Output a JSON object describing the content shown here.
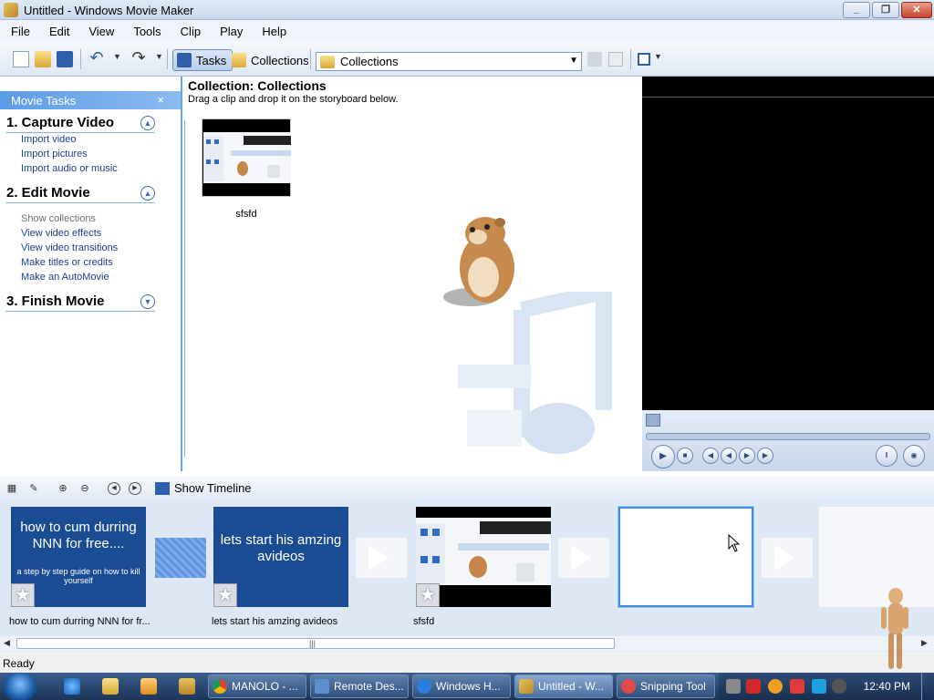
{
  "window": {
    "title": "Untitled - Windows Movie Maker"
  },
  "menu": [
    "File",
    "Edit",
    "View",
    "Tools",
    "Clip",
    "Play",
    "Help"
  ],
  "toolbar": {
    "tasks_label": "Tasks",
    "collections_label": "Collections",
    "collection_select": "Collections"
  },
  "tasks": {
    "header": "Movie Tasks",
    "close": "×",
    "sections": [
      {
        "title": "1. Capture Video",
        "links": [
          "Import video",
          "Import pictures",
          "Import audio or music"
        ]
      },
      {
        "title": "2. Edit Movie",
        "links": [
          "Show collections",
          "View video effects",
          "View video transitions",
          "Make titles or credits",
          "Make an AutoMovie"
        ]
      },
      {
        "title": "3. Finish Movie",
        "links": []
      }
    ]
  },
  "collection": {
    "title": "Collection: Collections",
    "subtitle": "Drag a clip and drop it on the storyboard below.",
    "clip_label": "sfsfd"
  },
  "storyboard": {
    "show_timeline": "Show Timeline",
    "clips": [
      {
        "caption": "how to cum durring NNN for fr...",
        "title_main": "how to cum durring NNN for free....",
        "title_sub": "a step by step guide on how to kill yourself"
      },
      {
        "caption": "lets start his amzing avideos",
        "title_main": "lets start his amzing avideos"
      },
      {
        "caption": "sfsfd"
      }
    ],
    "grip": "|||"
  },
  "status": {
    "text": "Ready"
  },
  "taskbar": {
    "buttons": [
      "MANOLO - ...",
      "Remote Des...",
      "Windows H...",
      "Untitled - W...",
      "Snipping Tool"
    ],
    "clock": "12:40 PM"
  },
  "colors": {
    "accent": "#3f8ce0",
    "title_card_bg": "#1a4c93"
  }
}
